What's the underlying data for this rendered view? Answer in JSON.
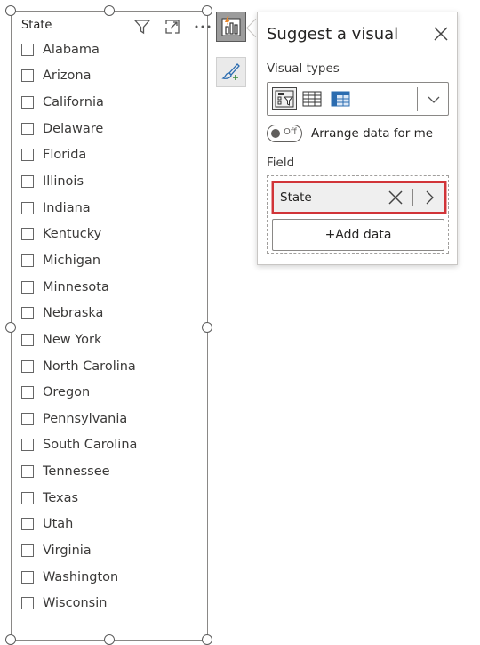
{
  "slicer": {
    "title": "State",
    "items": [
      {
        "label": "Alabama"
      },
      {
        "label": "Arizona"
      },
      {
        "label": "California"
      },
      {
        "label": "Delaware"
      },
      {
        "label": "Florida"
      },
      {
        "label": "Illinois"
      },
      {
        "label": "Indiana"
      },
      {
        "label": "Kentucky"
      },
      {
        "label": "Michigan"
      },
      {
        "label": "Minnesota"
      },
      {
        "label": "Nebraska"
      },
      {
        "label": "New York"
      },
      {
        "label": "North Carolina"
      },
      {
        "label": "Oregon"
      },
      {
        "label": "Pennsylvania"
      },
      {
        "label": "South Carolina"
      },
      {
        "label": "Tennessee"
      },
      {
        "label": "Texas"
      },
      {
        "label": "Utah"
      },
      {
        "label": "Virginia"
      },
      {
        "label": "Washington"
      },
      {
        "label": "Wisconsin"
      }
    ],
    "header_icons": [
      "filter-icon",
      "focus-mode-icon",
      "more-options-icon"
    ]
  },
  "side_buttons": [
    "suggest-visual-icon",
    "format-brush-icon"
  ],
  "panel": {
    "title": "Suggest a visual",
    "visual_types_label": "Visual types",
    "visual_type_icons": [
      "slicer-visual-icon",
      "table-visual-icon",
      "matrix-visual-icon"
    ],
    "toggle_state": "Off",
    "arrange_label": "Arrange data for me",
    "field_label": "Field",
    "field_value": "State",
    "add_data_label": "+Add data"
  },
  "colors": {
    "accent_red": "#d13438",
    "matrix_blue": "#2b6cb0",
    "lightning_orange": "#e8862a"
  }
}
